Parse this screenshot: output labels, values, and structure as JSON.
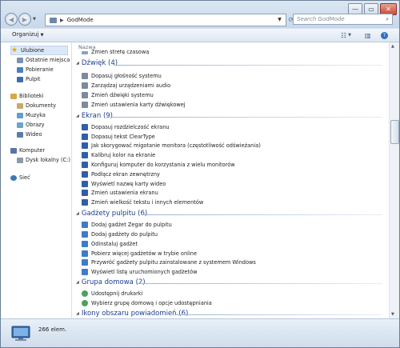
{
  "address": {
    "path": "GodMode"
  },
  "search": {
    "placeholder": "Search GodMode"
  },
  "toolbar": {
    "organize_label": "Organizuj"
  },
  "nav": [
    {
      "label": "Ulubione",
      "icon": "star-icon",
      "color": "#e0a800"
    },
    {
      "label": "Ostatnie miejsca",
      "icon": "recent-places-icon",
      "color": "#7a93b3"
    },
    {
      "label": "Pobieranie",
      "icon": "download-folder-icon",
      "color": "#4b7fc1"
    },
    {
      "label": "Pulpit",
      "icon": "desktop-icon",
      "color": "#3c6eb4"
    },
    {
      "label": "Biblioteki",
      "icon": "libraries-icon",
      "color": "#d6a847"
    },
    {
      "label": "Dokumenty",
      "icon": "documents-icon",
      "color": "#c9a968"
    },
    {
      "label": "Muzyka",
      "icon": "music-icon",
      "color": "#5f9ed6"
    },
    {
      "label": "Obrazy",
      "icon": "pictures-icon",
      "color": "#6aa4cf"
    },
    {
      "label": "Wideo",
      "icon": "video-icon",
      "color": "#597ea6"
    },
    {
      "label": "Komputer",
      "icon": "computer-icon",
      "color": "#5876a1"
    },
    {
      "label": "Dysk lokalny (C:)",
      "icon": "drive-icon",
      "color": "#8a9aab"
    },
    {
      "label": "Sieć",
      "icon": "network-icon",
      "color": "#3f78b5"
    }
  ],
  "content": {
    "column_header": "Nazwa",
    "partial_item": "Zmień strefę czasową",
    "groups": [
      {
        "title": "Dźwięk (4)",
        "items": [
          "Dopasuj głośność systemu",
          "Zarządzaj urządzeniami audio",
          "Zmień dźwięki systemu",
          "Zmień ustawienia karty dźwiękowej"
        ]
      },
      {
        "title": "Ekran (9)",
        "items": [
          "Dopasuj rozdzielczość ekranu",
          "Dopasuj tekst ClearType",
          "Jak skorygować migotanie monitora (częstotliwość odświeżania)",
          "Kalibruj kolor na ekranie",
          "Konfiguruj komputer do korzystania z wielu monitorów",
          "Podłącz ekran zewnętrzny",
          "Wyświetl nazwę karty wideo",
          "Zmień ustawienia ekranu",
          "Zmień wielkość tekstu i innych elementów"
        ]
      },
      {
        "title": "Gadżety pulpitu (6)",
        "items": [
          "Dodaj gadżet Zegar do pulpitu",
          "Dodaj gadżety do pulpitu",
          "Odinstaluj gadżet",
          "Pobierz więcej gadżetów w trybie online",
          "Przywróć gadżety pulpitu zainstalowane z systemem Windows",
          "Wyświetl listę uruchomionych gadżetów"
        ]
      },
      {
        "title": "Grupa domowa (2)",
        "items": [
          "Udostępnij drukarki",
          "Wybierz grupę domową i opcje udostępniania"
        ]
      },
      {
        "title": "Ikony obszaru powiadomień (6)",
        "items": []
      }
    ]
  },
  "status": {
    "count": "266 elem."
  },
  "colors": {
    "group_title": "#1e3d8f",
    "selection": "#dbe8f7"
  }
}
